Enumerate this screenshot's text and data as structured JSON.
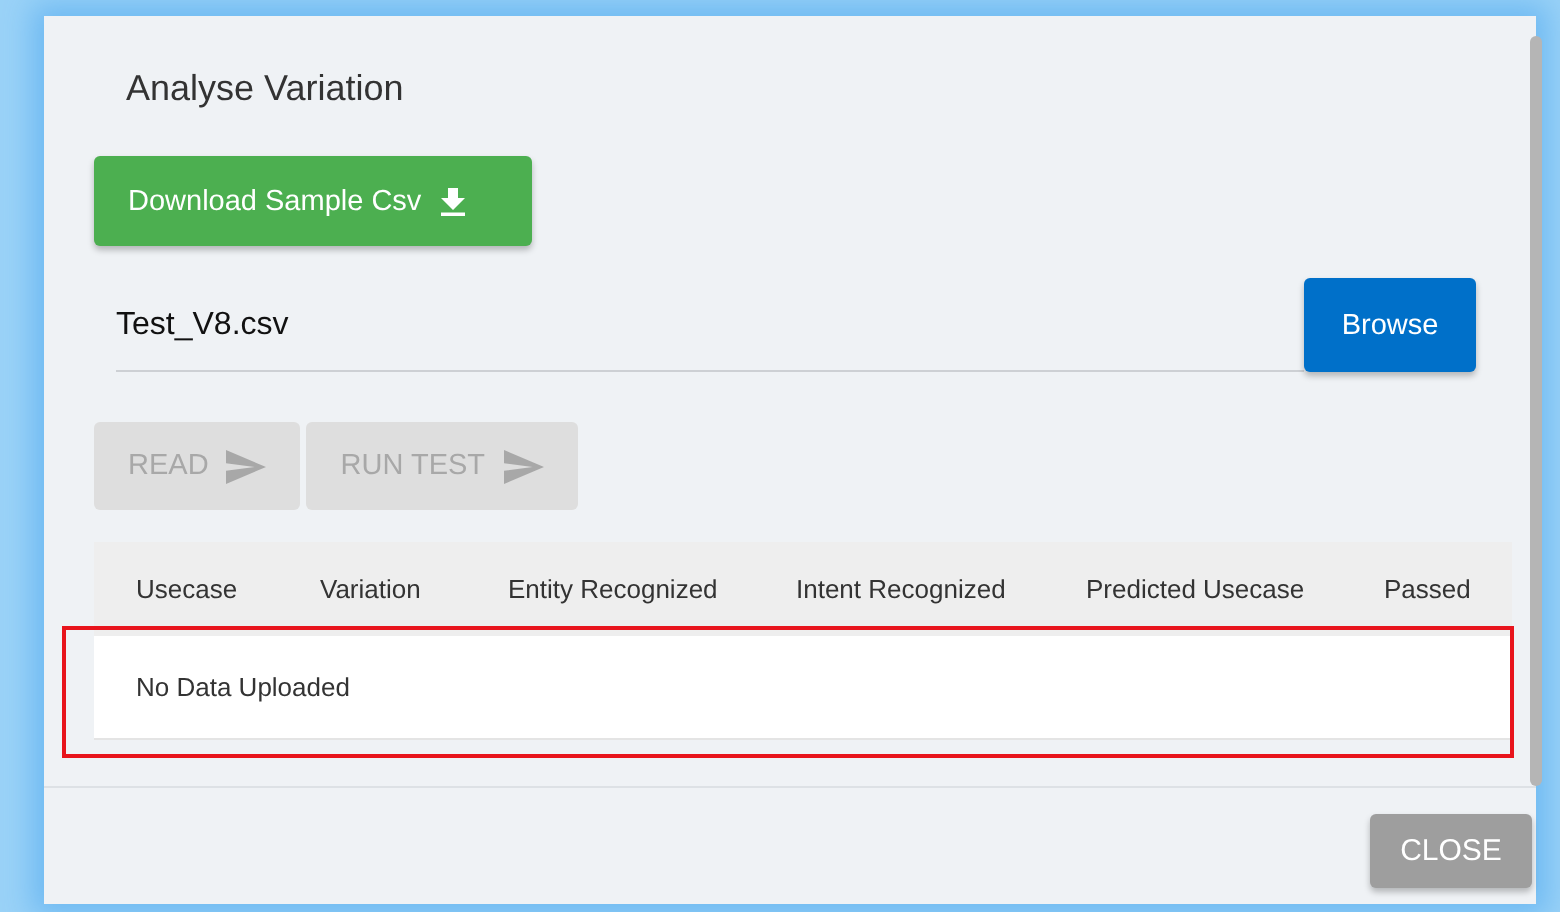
{
  "dialog": {
    "title": "Analyse Variation"
  },
  "download_button": {
    "label": "Download Sample Csv"
  },
  "file_field": {
    "value": "Test_V8.csv"
  },
  "browse_button": {
    "label": "Browse"
  },
  "actions": [
    {
      "label": "READ",
      "disabled": true
    },
    {
      "label": "RUN TEST",
      "disabled": true
    }
  ],
  "table": {
    "columns": [
      "Usecase",
      "Variation",
      "Entity Recognized",
      "Intent Recognized",
      "Predicted Usecase",
      "Passed"
    ],
    "empty_message": "No Data Uploaded"
  },
  "close_button": {
    "label": "CLOSE"
  }
}
